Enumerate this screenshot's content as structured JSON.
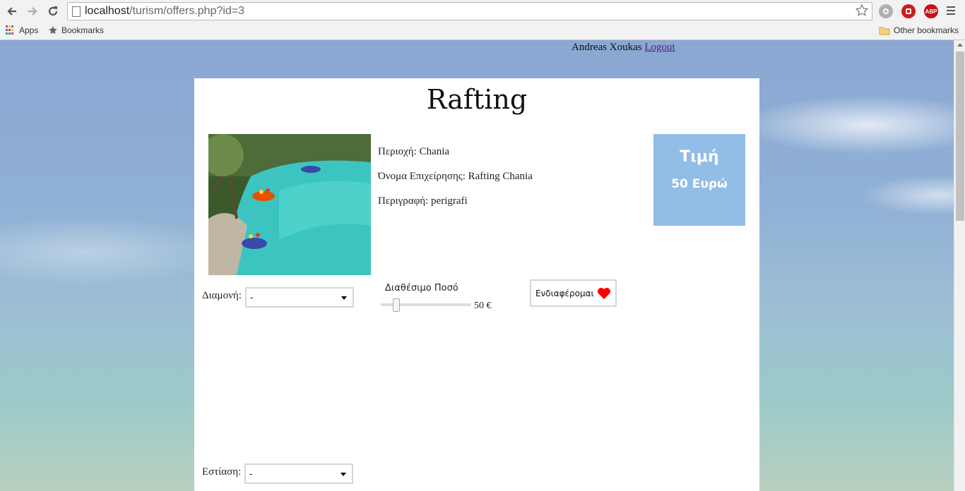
{
  "browser": {
    "url_host": "localhost",
    "url_path": "/turism/offers.php?id=3",
    "bookmarks": [
      {
        "label": "Apps"
      },
      {
        "label": "Bookmarks"
      }
    ],
    "other_bookmarks": "Other bookmarks",
    "extensions": [
      {
        "name": "extension-gray-icon",
        "color": "#b0b0b0"
      },
      {
        "name": "stop-sign-icon",
        "color": "#cc1b1b"
      },
      {
        "name": "adblock-plus-icon",
        "color": "#c4121a",
        "text": "ABP"
      }
    ]
  },
  "user": {
    "name": "Andreas Xoukas",
    "logout_label": "Logout"
  },
  "offer": {
    "title": "Rafting",
    "region": "Περιοχή: Chania",
    "business": "Όνομα Επιχείρησης: Rafting Chania",
    "description": "Περιγραφή: perigrafi",
    "price_label": "Τιμή",
    "price_value": "50 Ευρώ",
    "accent_color": "#92bde6"
  },
  "filters": {
    "accommodation_label": "Διαμονή:",
    "accommodation_value": "-",
    "dining_label": "Εστίαση:",
    "dining_value": "-",
    "budget_label": "Διαθέσιμο Ποσό",
    "budget_value": "50 €",
    "budget_level": 0.14,
    "interest_label": "Ενδιαφέρομαι",
    "heart_color": "#ff0000"
  }
}
